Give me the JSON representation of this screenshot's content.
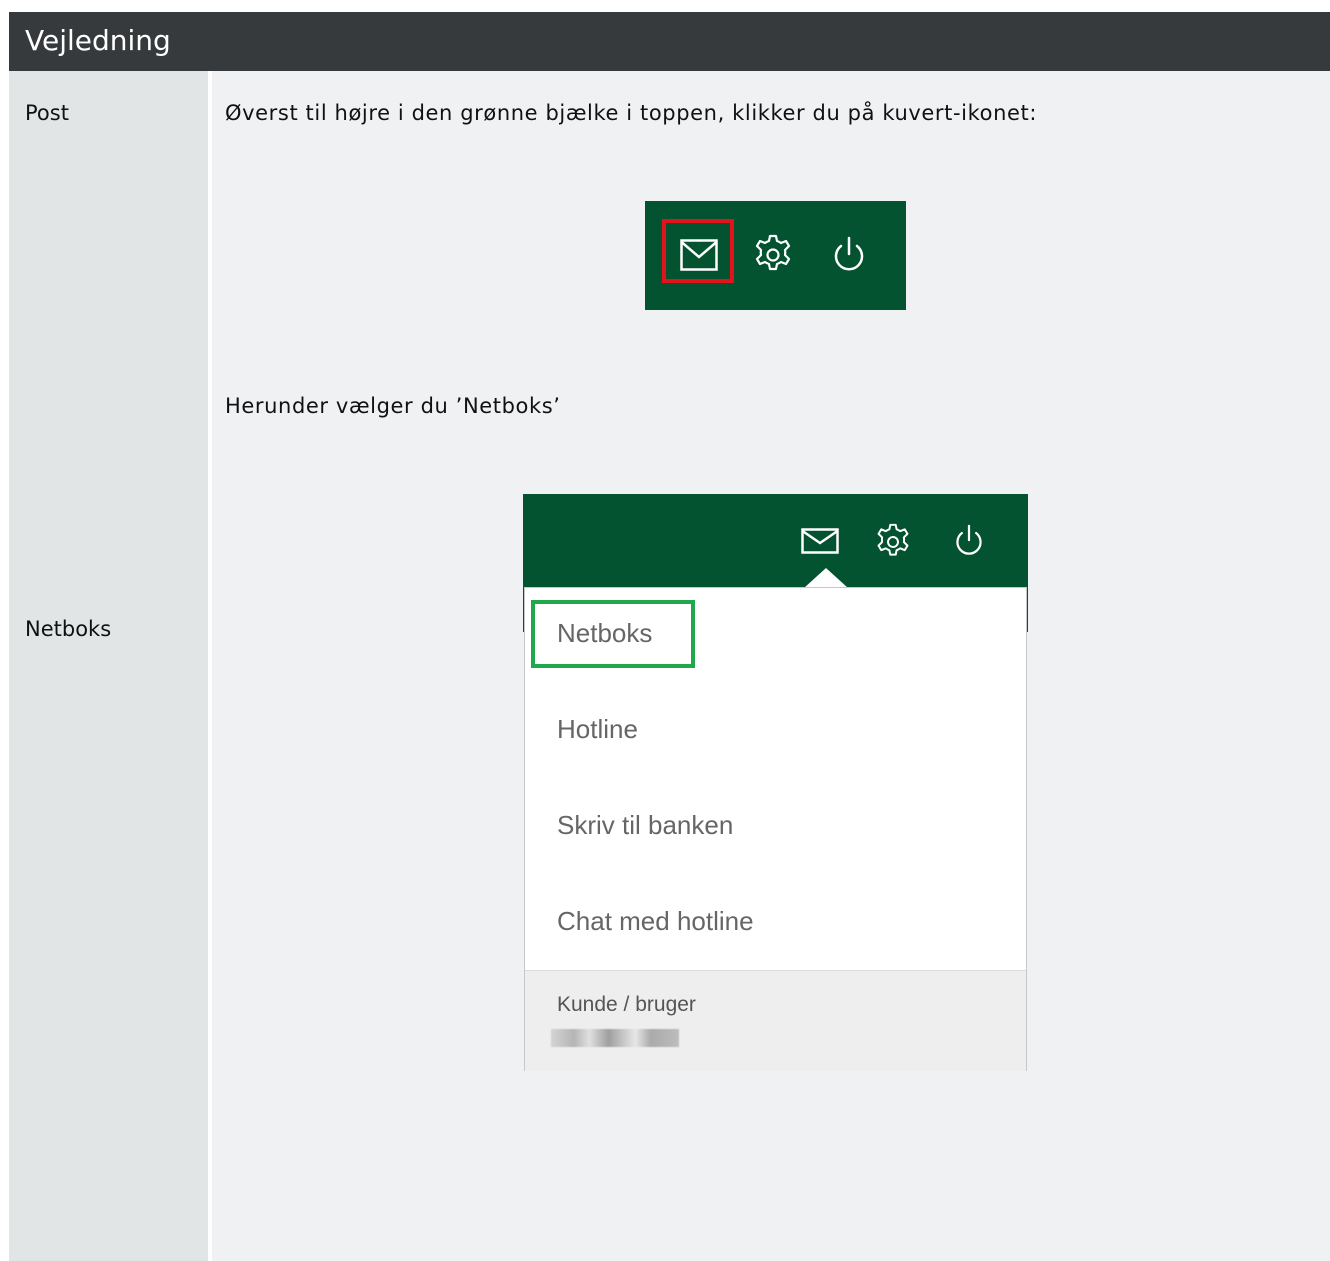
{
  "header": {
    "title": "Vejledning"
  },
  "rows": [
    {
      "label": "Post"
    },
    {
      "label": "Netboks"
    }
  ],
  "content": {
    "instruction_1": "Øverst til højre i den grønne bjælke i toppen, klikker du på kuvert-ikonet:",
    "instruction_2": "Herunder vælger du ’Netboks’"
  },
  "screenshot_menu": {
    "items": [
      "Netboks",
      "Hotline",
      "Skriv til banken",
      "Chat med hotline"
    ],
    "footer_label": "Kunde / bruger"
  },
  "colors": {
    "header_bg": "#373a3c",
    "bank_green": "#035230",
    "highlight_red": "#e3131b",
    "highlight_green": "#1fa84c"
  },
  "icons": [
    "envelope-icon",
    "gear-icon",
    "power-icon"
  ]
}
